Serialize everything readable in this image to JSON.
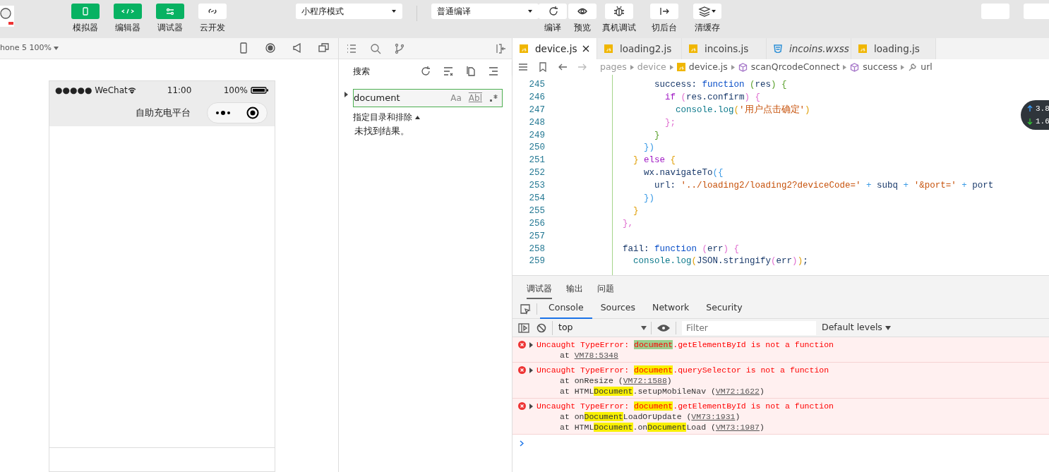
{
  "toolbar": {
    "mode_buttons": [
      {
        "label": "模拟器",
        "on": true
      },
      {
        "label": "编辑器",
        "on": true
      },
      {
        "label": "调试器",
        "on": true
      },
      {
        "label": "云开发",
        "on": false
      }
    ],
    "mode_select": "小程序模式",
    "compile_select": "普通编译",
    "actions": [
      "编译",
      "预览",
      "真机调试",
      "切后台",
      "清缓存"
    ]
  },
  "simulator": {
    "device": "hone 5 100%",
    "status": {
      "carrier": "●●●●● WeChat",
      "time": "11:00",
      "battery": "100%"
    },
    "page_title": "自助充电平台"
  },
  "search": {
    "title": "搜索",
    "query": "document",
    "options": [
      "Aa",
      "Abl"
    ],
    "scope_label": "指定目录和排除",
    "result": "未找到结果。"
  },
  "editor": {
    "tabs": [
      {
        "name": "device.js",
        "kind": "js",
        "selected": true,
        "preview": false
      },
      {
        "name": "loading2.js",
        "kind": "js",
        "selected": false,
        "preview": false
      },
      {
        "name": "incoins.js",
        "kind": "js",
        "selected": false,
        "preview": false
      },
      {
        "name": "incoins.wxss",
        "kind": "wxss",
        "selected": false,
        "preview": true
      },
      {
        "name": "loading.js",
        "kind": "js",
        "selected": false,
        "preview": false
      }
    ],
    "breadcrumb": [
      {
        "kind": "folder",
        "text": "pages"
      },
      {
        "kind": "folder",
        "text": "device"
      },
      {
        "kind": "file",
        "text": "device.js"
      },
      {
        "kind": "symbol",
        "text": "scanQrcodeConnect"
      },
      {
        "kind": "symbol",
        "text": "success"
      },
      {
        "kind": "property",
        "text": "url"
      }
    ],
    "lines": [
      {
        "n": "245",
        "tokens": [
          {
            "kind": "p",
            "text": "                  success: "
          },
          {
            "kind": "kw",
            "text": "function"
          },
          {
            "kind": "g",
            "text": " ("
          },
          {
            "kind": "p",
            "text": "res"
          },
          {
            "kind": "g",
            "text": ") {"
          }
        ]
      },
      {
        "n": "246",
        "tokens": [
          {
            "kind": "ctl",
            "text": "                    if"
          },
          {
            "kind": "k",
            "text": " ("
          },
          {
            "kind": "p",
            "text": "res.confirm"
          },
          {
            "kind": "k",
            "text": ") {"
          }
        ]
      },
      {
        "n": "247",
        "tokens": [
          {
            "kind": "fn",
            "text": "                      console.log"
          },
          {
            "kind": "y",
            "text": "("
          },
          {
            "kind": "s",
            "text": "'用户点击确定'"
          },
          {
            "kind": "y",
            "text": ")"
          }
        ]
      },
      {
        "n": "248",
        "tokens": [
          {
            "kind": "k",
            "text": "                    };"
          }
        ]
      },
      {
        "n": "249",
        "tokens": [
          {
            "kind": "g",
            "text": "                  }"
          }
        ]
      },
      {
        "n": "250",
        "tokens": [
          {
            "kind": "b",
            "text": "                })"
          }
        ]
      },
      {
        "n": "251",
        "tokens": [
          {
            "kind": "y",
            "text": "              }"
          },
          {
            "kind": "ctl",
            "text": " else"
          },
          {
            "kind": "y",
            "text": " {"
          }
        ]
      },
      {
        "n": "252",
        "tokens": [
          {
            "kind": "p",
            "text": "                wx.navigateTo"
          },
          {
            "kind": "b",
            "text": "({"
          }
        ]
      },
      {
        "n": "253",
        "tokens": [
          {
            "kind": "p",
            "text": "                  url: "
          },
          {
            "kind": "s",
            "text": "'../loading2/loading2?deviceCode='"
          },
          {
            "kind": "b",
            "text": " +"
          },
          {
            "kind": "p",
            "text": " subq "
          },
          {
            "kind": "b",
            "text": "+"
          },
          {
            "kind": "s",
            "text": " '&port='"
          },
          {
            "kind": "b",
            "text": " +"
          },
          {
            "kind": "p",
            "text": " port"
          }
        ]
      },
      {
        "n": "254",
        "tokens": [
          {
            "kind": "b",
            "text": "                })"
          }
        ]
      },
      {
        "n": "255",
        "tokens": [
          {
            "kind": "y",
            "text": "              }"
          }
        ]
      },
      {
        "n": "256",
        "tokens": [
          {
            "kind": "k",
            "text": "            },"
          }
        ]
      },
      {
        "n": "257"
      },
      {
        "n": "258",
        "tokens": [
          {
            "kind": "p",
            "text": "            fail: "
          },
          {
            "kind": "kw",
            "text": "function"
          },
          {
            "kind": "k",
            "text": " ("
          },
          {
            "kind": "p",
            "text": "err"
          },
          {
            "kind": "k",
            "text": ") {"
          }
        ]
      },
      {
        "n": "259",
        "tokens": [
          {
            "kind": "fn",
            "text": "              console.log"
          },
          {
            "kind": "y",
            "text": "("
          },
          {
            "kind": "p",
            "text": "JSON.stringify"
          },
          {
            "kind": "k",
            "text": "("
          },
          {
            "kind": "p",
            "text": "err"
          },
          {
            "kind": "k",
            "text": ")"
          },
          {
            "kind": "y",
            "text": ")"
          },
          {
            "kind": "p",
            "text": ";"
          }
        ]
      }
    ],
    "network": [
      {
        "kind": "up",
        "value": "3.8"
      },
      {
        "kind": "down",
        "value": "1.6"
      }
    ]
  },
  "devtools": {
    "tabs": [
      {
        "label": "调试器",
        "selected": true
      },
      {
        "label": "输出",
        "selected": false
      },
      {
        "label": "问题",
        "selected": false
      }
    ],
    "panel_tabs": [
      {
        "label": "Console",
        "selected": true
      },
      {
        "label": "Sources",
        "selected": false
      },
      {
        "label": "Network",
        "selected": false
      },
      {
        "label": "Security",
        "selected": false
      }
    ],
    "context": "top",
    "filter_placeholder": "Filter",
    "levels": "Default levels",
    "messages": [
      {
        "lines": [
          [
            {
              "kind": "text",
              "text": "Uncaught TypeError: "
            },
            {
              "kind": "current",
              "text": "document"
            },
            {
              "kind": "text",
              "text": ".getElementById is not a function"
            }
          ],
          [
            {
              "kind": "text",
              "text": "at "
            },
            {
              "kind": "link",
              "text": "VM78:5348"
            }
          ]
        ]
      },
      {
        "lines": [
          [
            {
              "kind": "text",
              "text": "Uncaught TypeError: "
            },
            {
              "kind": "match",
              "text": "document"
            },
            {
              "kind": "text",
              "text": ".querySelector is not a function"
            }
          ],
          [
            {
              "kind": "text",
              "text": "at onResize ("
            },
            {
              "kind": "link",
              "text": "VM72:1588"
            },
            {
              "kind": "text",
              "text": ")"
            }
          ],
          [
            {
              "kind": "text",
              "text": "at HTML"
            },
            {
              "kind": "match",
              "text": "Document"
            },
            {
              "kind": "text",
              "text": ".setupMobileNav ("
            },
            {
              "kind": "link",
              "text": "VM72:1622"
            },
            {
              "kind": "text",
              "text": ")"
            }
          ]
        ]
      },
      {
        "lines": [
          [
            {
              "kind": "text",
              "text": "Uncaught TypeError: "
            },
            {
              "kind": "match",
              "text": "document"
            },
            {
              "kind": "text",
              "text": ".getElementById is not a function"
            }
          ],
          [
            {
              "kind": "text",
              "text": "at on"
            },
            {
              "kind": "match",
              "text": "Document"
            },
            {
              "kind": "text",
              "text": "LoadOrUpdate ("
            },
            {
              "kind": "link",
              "text": "VM73:1931"
            },
            {
              "kind": "text",
              "text": ")"
            }
          ],
          [
            {
              "kind": "text",
              "text": "at HTML"
            },
            {
              "kind": "match",
              "text": "Document"
            },
            {
              "kind": "text",
              "text": ".on"
            },
            {
              "kind": "match",
              "text": "Document"
            },
            {
              "kind": "text",
              "text": "Load ("
            },
            {
              "kind": "link",
              "text": "VM73:1987"
            },
            {
              "kind": "text",
              "text": ")"
            }
          ]
        ]
      }
    ]
  }
}
